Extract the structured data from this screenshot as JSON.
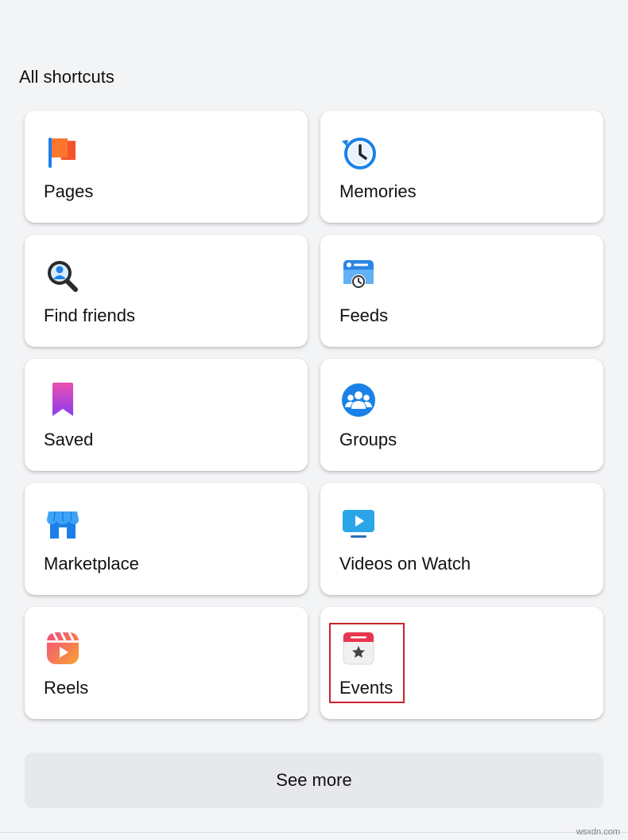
{
  "section": {
    "title": "All shortcuts"
  },
  "shortcuts": [
    {
      "label": "Pages",
      "icon": "pages-flag-icon"
    },
    {
      "label": "Memories",
      "icon": "memories-clock-icon"
    },
    {
      "label": "Find friends",
      "icon": "find-friends-icon"
    },
    {
      "label": "Feeds",
      "icon": "feeds-icon"
    },
    {
      "label": "Saved",
      "icon": "saved-bookmark-icon"
    },
    {
      "label": "Groups",
      "icon": "groups-icon"
    },
    {
      "label": "Marketplace",
      "icon": "marketplace-store-icon"
    },
    {
      "label": "Videos on Watch",
      "icon": "watch-video-icon"
    },
    {
      "label": "Reels",
      "icon": "reels-icon"
    },
    {
      "label": "Events",
      "icon": "events-calendar-icon"
    }
  ],
  "see_more": {
    "label": "See more"
  },
  "watermark": "wsxdn.com",
  "colors": {
    "background": "#f3f4f6",
    "card": "#ffffff",
    "see_more_bg": "#e6e8eb",
    "highlight": "#c8232c",
    "blue": "#1877f2"
  }
}
